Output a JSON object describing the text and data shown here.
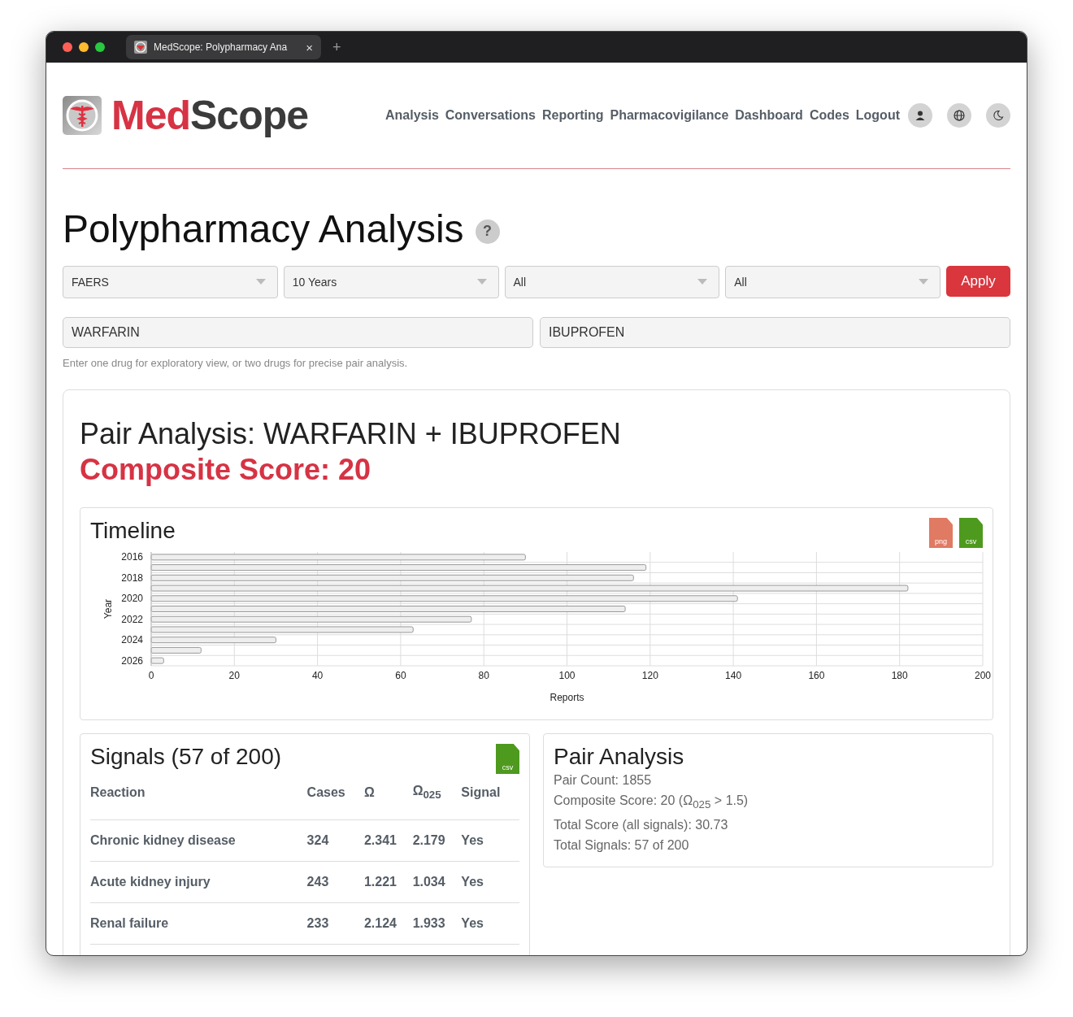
{
  "browser": {
    "tab_title": "MedScope: Polypharmacy Ana",
    "close": "×",
    "new_tab": "+"
  },
  "header": {
    "brand_first": "Med",
    "brand_second": "Scope",
    "nav": [
      "Analysis",
      "Conversations",
      "Reporting",
      "Pharmacovigilance",
      "Dashboard",
      "Codes",
      "Logout"
    ]
  },
  "page": {
    "title": "Polypharmacy Analysis",
    "help": "?"
  },
  "filters": [
    {
      "value": "FAERS"
    },
    {
      "value": "10 Years"
    },
    {
      "value": "All"
    },
    {
      "value": "All"
    }
  ],
  "apply": "Apply",
  "drugs": [
    {
      "value": "WARFARIN"
    },
    {
      "value": "IBUPROFEN"
    }
  ],
  "hint": "Enter one drug for exploratory view, or two drugs for precise pair analysis.",
  "result": {
    "heading": "Pair Analysis: WARFARIN + IBUPROFEN",
    "score": "Composite Score: 20"
  },
  "timeline": {
    "title": "Timeline",
    "downloads": [
      {
        "kind": "png",
        "label": "png"
      },
      {
        "kind": "csv",
        "label": "csv"
      }
    ],
    "chart_data": {
      "type": "bar",
      "orientation": "horizontal",
      "xlabel": "Reports",
      "ylabel": "Year",
      "categories": [
        "2016",
        null,
        "2018",
        null,
        "2020",
        null,
        "2022",
        null,
        "2024",
        null,
        "2026"
      ],
      "values": [
        90,
        119,
        116,
        182,
        141,
        114,
        77,
        63,
        30,
        12,
        3
      ],
      "xlim": [
        0,
        200
      ],
      "xticks": [
        0,
        20,
        40,
        60,
        80,
        100,
        120,
        140,
        160,
        180,
        200
      ],
      "grid": true
    }
  },
  "signals": {
    "title": "Signals (57 of 200)",
    "download": {
      "kind": "csv",
      "label": "csv"
    },
    "columns": [
      "Reaction",
      "Cases",
      "Ω",
      "Ω$_{025}$",
      "Signal"
    ],
    "rows": [
      [
        "Chronic kidney disease",
        "324",
        "2.341",
        "2.179",
        "Yes"
      ],
      [
        "Acute kidney injury",
        "243",
        "1.221",
        "1.034",
        "Yes"
      ],
      [
        "Renal failure",
        "233",
        "2.124",
        "1.933",
        "Yes"
      ]
    ]
  },
  "pair_analysis": {
    "title": "Pair Analysis",
    "lines": [
      "Pair Count: 1855",
      "Composite Score: 20 (Ω$_{025}$ > 1.5)",
      "Total Score (all signals): 30.73",
      "Total Signals: 57 of 200"
    ]
  }
}
